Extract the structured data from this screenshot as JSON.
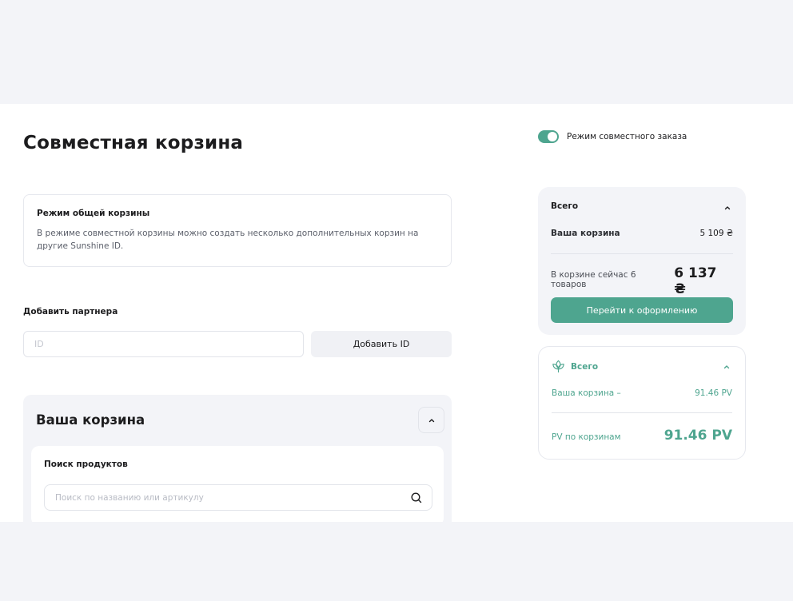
{
  "page": {
    "title": "Совместная корзина"
  },
  "info": {
    "title": "Режим общей корзины",
    "text": "В режиме совместной корзины можно создать несколько дополнительных корзин на другие Sunshine ID."
  },
  "partner": {
    "label": "Добавить партнера",
    "placeholder": "ID",
    "add_button": "Добавить ID"
  },
  "cart": {
    "title": "Ваша корзина",
    "search_title": "Поиск продуктов",
    "search_placeholder": "Поиск по названию или артикулу"
  },
  "joint_toggle": {
    "label": "Режим совместного заказа",
    "on": true
  },
  "summary": {
    "header": "Всего",
    "cart_label": "Ваша корзина",
    "cart_value": "5 109 ₴",
    "total_label": "В корзине сейчас 6 товаров",
    "total_value": "6 137 ₴",
    "checkout_button": "Перейти к оформлению"
  },
  "pv": {
    "header": "Всего",
    "cart_label": "Ваша корзина –",
    "cart_value": "91.46 PV",
    "total_label": "PV по корзинам",
    "total_value": "91.46 PV"
  },
  "colors": {
    "accent": "#4ea58f",
    "background": "#f3f4f8",
    "panel": "#ffffff"
  },
  "icons": {
    "search": "search-icon",
    "chevron": "chevron-up-icon",
    "leaf": "leaf-icon"
  }
}
